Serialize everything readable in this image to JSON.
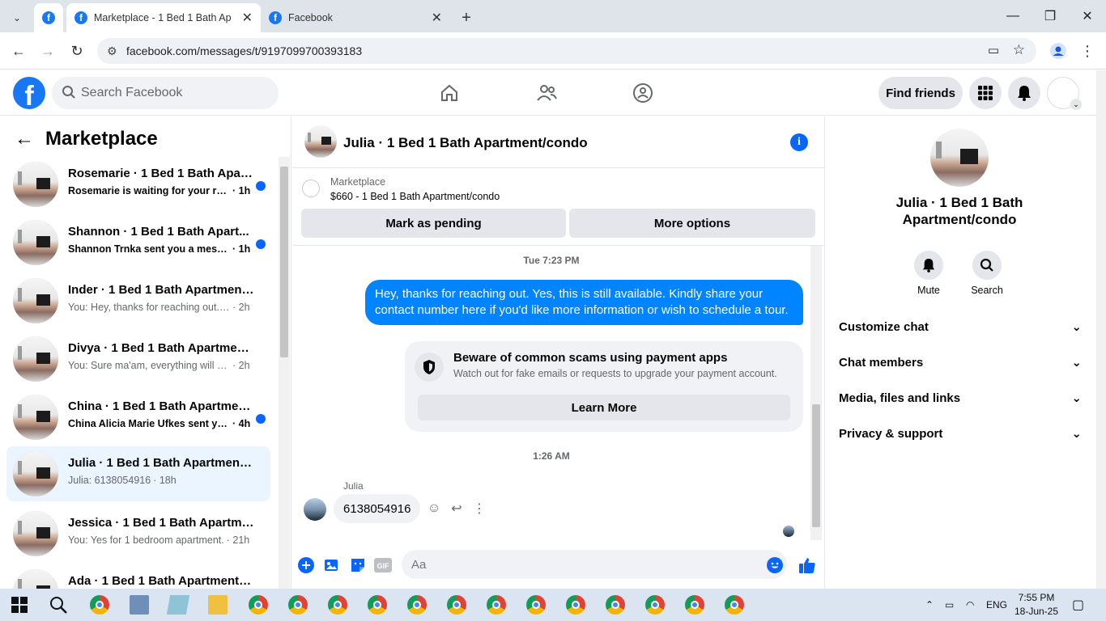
{
  "browser": {
    "tabs": [
      {
        "title": "Marketplace - 1 Bed 1 Bath Apa"
      },
      {
        "title": "Facebook"
      }
    ],
    "url": "facebook.com/messages/t/9197099700393183"
  },
  "header": {
    "search_placeholder": "Search Facebook",
    "find_friends": "Find friends"
  },
  "left": {
    "title": "Marketplace",
    "conversations": [
      {
        "name": "Rosemarie · 1 Bed 1 Bath Apart...",
        "preview": "Rosemarie is waiting for your re...",
        "time": "· 1h",
        "unread": true
      },
      {
        "name": "Shannon · 1 Bed 1 Bath Apart...",
        "preview": "Shannon Trnka sent you a mess...",
        "time": "· 1h",
        "unread": true
      },
      {
        "name": "Inder · 1 Bed 1 Bath Apartment/...",
        "preview": "You: Hey, thanks for reaching out. Y...",
        "time": "· 2h",
        "unread": false
      },
      {
        "name": "Divya · 1 Bed 1 Bath Apartment/...",
        "preview": "You: Sure ma'am, everything will b...",
        "time": "· 2h",
        "unread": false
      },
      {
        "name": "China · 1 Bed 1 Bath Apartmen...",
        "preview": "China Alicia Marie Ufkes sent yo...",
        "time": "· 4h",
        "unread": true
      },
      {
        "name": "Julia · 1 Bed 1 Bath Apartment/c...",
        "preview": "Julia: 6138054916",
        "time": "· 18h",
        "unread": false,
        "selected": true
      },
      {
        "name": "Jessica · 1 Bed 1 Bath Apartment...",
        "preview": "You: Yes for 1 bedroom apartment.",
        "time": "· 21h",
        "unread": false
      },
      {
        "name": "Ada · 1 Bed 1 Bath Apartment/c...",
        "preview": "",
        "time": "",
        "unread": false
      }
    ]
  },
  "chat": {
    "title": "Julia · 1 Bed 1 Bath Apartment/condo",
    "marketplace_label": "Marketplace",
    "listing": "$660 - 1 Bed 1 Bath Apartment/condo",
    "mark_pending": "Mark as pending",
    "more_options": "More options",
    "timestamp1": "Tue 7:23 PM",
    "outgoing": "Hey, thanks for reaching out. Yes, this is still available. Kindly share your contact number here if you'd like more information or wish to schedule a tour.",
    "scam_title": "Beware of common scams using payment apps",
    "scam_text": "Watch out for fake emails or requests to upgrade your payment account.",
    "learn_more": "Learn More",
    "timestamp2": "1:26 AM",
    "sender": "Julia",
    "incoming": "6138054916",
    "composer_placeholder": "Aa"
  },
  "right": {
    "title": "Julia · 1 Bed 1 Bath Apartment/condo",
    "mute": "Mute",
    "search": "Search",
    "sections": [
      "Customize chat",
      "Chat members",
      "Media, files and links",
      "Privacy & support"
    ]
  },
  "taskbar": {
    "lang": "ENG",
    "time": "7:55 PM",
    "date": "18-Jun-25"
  },
  "colors": {
    "fb_blue": "#1877f2",
    "bubble_blue": "#0084ff",
    "unread_dot": "#0866ff"
  }
}
